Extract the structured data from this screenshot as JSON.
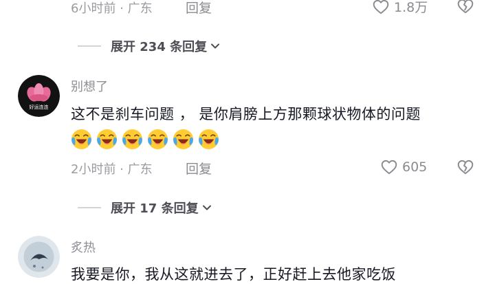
{
  "comment_prev": {
    "time_location": "6小时前 · 广东",
    "reply_label": "回复",
    "like_count": "1.8万"
  },
  "expand_1": {
    "label": "展开 234 条回复"
  },
  "comment_1": {
    "username": "别想了",
    "avatar_text": "好运连连",
    "text": "这不是刹车问题 ， 是你肩膀上方那颗球状物体的问题",
    "emojis": [
      "laughing-crying-emoji",
      "laughing-crying-emoji",
      "laughing-crying-emoji",
      "laughing-crying-emoji",
      "laughing-crying-emoji",
      "laughing-crying-emoji"
    ],
    "time_location": "2小时前 · 广东",
    "reply_label": "回复",
    "like_count": "605"
  },
  "expand_2": {
    "label": "展开 17 条回复"
  },
  "comment_2": {
    "username": "炙热",
    "text": "我要是你，我从这就进去了，正好赶上去他家吃饭"
  },
  "icons": {
    "like": "heart-outline-icon",
    "dislike": "broken-heart-icon",
    "expand": "chevron-down-icon"
  },
  "colors": {
    "meta_text": "#9a9ba0",
    "content_text": "#161823",
    "expand_text": "#4d4e55",
    "emoji_yellow": "#ffcc33",
    "emoji_tear": "#4aa8ea"
  }
}
